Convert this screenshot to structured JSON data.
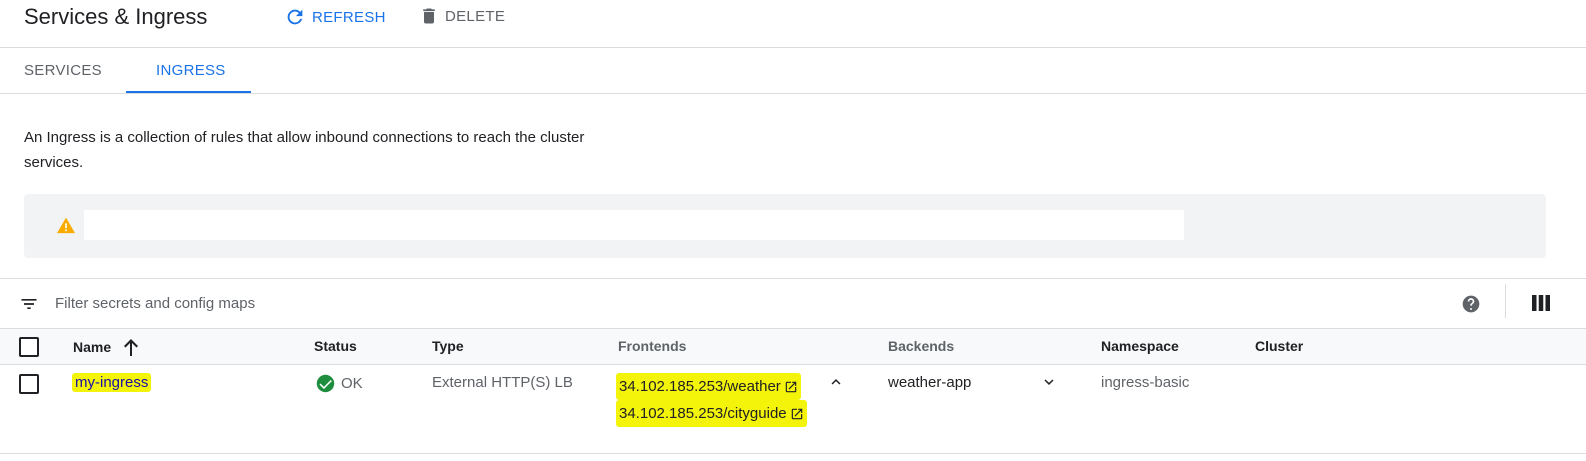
{
  "header": {
    "title": "Services & Ingress",
    "refresh_label": "REFRESH",
    "delete_label": "DELETE"
  },
  "tabs": [
    {
      "label": "SERVICES",
      "active": false
    },
    {
      "label": "INGRESS",
      "active": true
    }
  ],
  "description": "An Ingress is a collection of rules that allow inbound connections to reach the cluster services.",
  "warning": {
    "icon": "warning-icon",
    "color": "#f9ab00"
  },
  "filter": {
    "placeholder": "Filter secrets and config maps",
    "value": ""
  },
  "table": {
    "columns": [
      "Name",
      "Status",
      "Type",
      "Frontends",
      "Backends",
      "Namespace",
      "Cluster"
    ],
    "sort": {
      "column": "Name",
      "direction": "ascending"
    },
    "rows": [
      {
        "name": "my-ingress",
        "status": "OK",
        "type": "External HTTP(S) LB",
        "frontends": [
          "34.102.185.253/weather",
          "34.102.185.253/cityguide"
        ],
        "backends": "weather-app",
        "namespace": "ingress-basic",
        "cluster": ""
      }
    ]
  },
  "colors": {
    "accent": "#1a73e8",
    "ok": "#1e8e3e",
    "highlight": "#f4f40a"
  }
}
